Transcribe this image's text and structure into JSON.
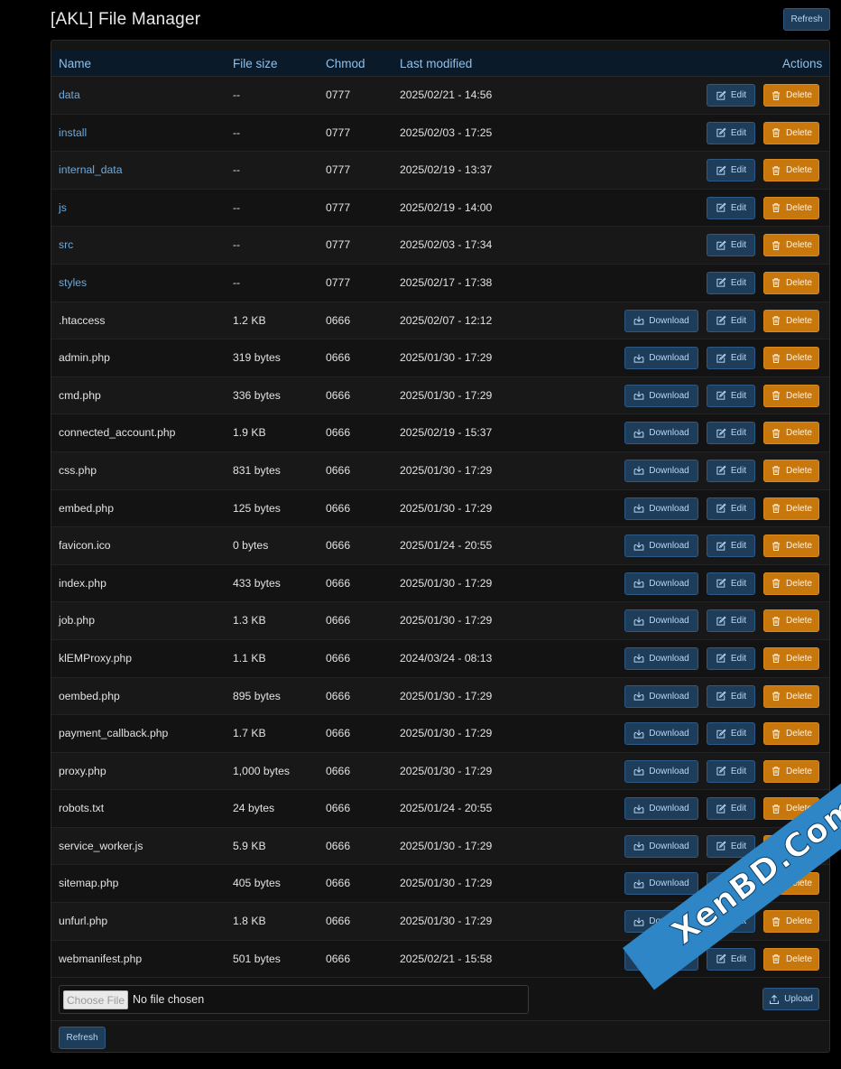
{
  "page_title": "[AKL] File Manager",
  "top_refresh_label": "Refresh",
  "table": {
    "headers": {
      "name": "Name",
      "size": "File size",
      "chmod": "Chmod",
      "modified": "Last modified",
      "actions": "Actions"
    },
    "labels": {
      "download": "Download",
      "edit": "Edit",
      "delete": "Delete"
    },
    "rows": [
      {
        "name": "data",
        "size": "--",
        "chmod": "0777",
        "modified": "2025/02/21 - 14:56",
        "is_dir": true
      },
      {
        "name": "install",
        "size": "--",
        "chmod": "0777",
        "modified": "2025/02/03 - 17:25",
        "is_dir": true
      },
      {
        "name": "internal_data",
        "size": "--",
        "chmod": "0777",
        "modified": "2025/02/19 - 13:37",
        "is_dir": true
      },
      {
        "name": "js",
        "size": "--",
        "chmod": "0777",
        "modified": "2025/02/19 - 14:00",
        "is_dir": true
      },
      {
        "name": "src",
        "size": "--",
        "chmod": "0777",
        "modified": "2025/02/03 - 17:34",
        "is_dir": true
      },
      {
        "name": "styles",
        "size": "--",
        "chmod": "0777",
        "modified": "2025/02/17 - 17:38",
        "is_dir": true
      },
      {
        "name": ".htaccess",
        "size": "1.2 KB",
        "chmod": "0666",
        "modified": "2025/02/07 - 12:12",
        "is_dir": false
      },
      {
        "name": "admin.php",
        "size": "319 bytes",
        "chmod": "0666",
        "modified": "2025/01/30 - 17:29",
        "is_dir": false
      },
      {
        "name": "cmd.php",
        "size": "336 bytes",
        "chmod": "0666",
        "modified": "2025/01/30 - 17:29",
        "is_dir": false
      },
      {
        "name": "connected_account.php",
        "size": "1.9 KB",
        "chmod": "0666",
        "modified": "2025/02/19 - 15:37",
        "is_dir": false
      },
      {
        "name": "css.php",
        "size": "831 bytes",
        "chmod": "0666",
        "modified": "2025/01/30 - 17:29",
        "is_dir": false
      },
      {
        "name": "embed.php",
        "size": "125 bytes",
        "chmod": "0666",
        "modified": "2025/01/30 - 17:29",
        "is_dir": false
      },
      {
        "name": "favicon.ico",
        "size": "0 bytes",
        "chmod": "0666",
        "modified": "2025/01/24 - 20:55",
        "is_dir": false
      },
      {
        "name": "index.php",
        "size": "433 bytes",
        "chmod": "0666",
        "modified": "2025/01/30 - 17:29",
        "is_dir": false
      },
      {
        "name": "job.php",
        "size": "1.3 KB",
        "chmod": "0666",
        "modified": "2025/01/30 - 17:29",
        "is_dir": false
      },
      {
        "name": "klEMProxy.php",
        "size": "1.1 KB",
        "chmod": "0666",
        "modified": "2024/03/24 - 08:13",
        "is_dir": false
      },
      {
        "name": "oembed.php",
        "size": "895 bytes",
        "chmod": "0666",
        "modified": "2025/01/30 - 17:29",
        "is_dir": false
      },
      {
        "name": "payment_callback.php",
        "size": "1.7 KB",
        "chmod": "0666",
        "modified": "2025/01/30 - 17:29",
        "is_dir": false
      },
      {
        "name": "proxy.php",
        "size": "1,000 bytes",
        "chmod": "0666",
        "modified": "2025/01/30 - 17:29",
        "is_dir": false
      },
      {
        "name": "robots.txt",
        "size": "24 bytes",
        "chmod": "0666",
        "modified": "2025/01/24 - 20:55",
        "is_dir": false
      },
      {
        "name": "service_worker.js",
        "size": "5.9 KB",
        "chmod": "0666",
        "modified": "2025/01/30 - 17:29",
        "is_dir": false
      },
      {
        "name": "sitemap.php",
        "size": "405 bytes",
        "chmod": "0666",
        "modified": "2025/01/30 - 17:29",
        "is_dir": false
      },
      {
        "name": "unfurl.php",
        "size": "1.8 KB",
        "chmod": "0666",
        "modified": "2025/01/30 - 17:29",
        "is_dir": false
      },
      {
        "name": "webmanifest.php",
        "size": "501 bytes",
        "chmod": "0666",
        "modified": "2025/02/21 - 15:58",
        "is_dir": false
      }
    ]
  },
  "upload": {
    "choose_file_label": "Choose File",
    "file_status": "No file chosen",
    "upload_label": "Upload"
  },
  "bottom_refresh_label": "Refresh",
  "watermark": "XenBD.Com",
  "colors": {
    "background": "#000000",
    "panel": "#151515",
    "header_bg": "#0b1a28",
    "link": "#6fa9da",
    "button_blue": "#1e3d5b",
    "button_orange": "#c8770c"
  }
}
